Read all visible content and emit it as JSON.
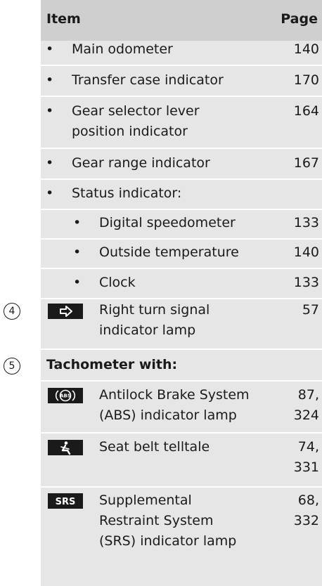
{
  "header": {
    "item": "Item",
    "page": "Page"
  },
  "rows": [
    {
      "label": "Main odometer",
      "page": "140"
    },
    {
      "label": "Transfer case indicator",
      "page": "170"
    },
    {
      "label_line1": "Gear selector lever",
      "label_line2": "position indicator",
      "page": "164"
    },
    {
      "label": "Gear range indicator",
      "page": "167"
    },
    {
      "label": "Status indicator:"
    },
    {
      "label": "Digital speedometer",
      "page": "133"
    },
    {
      "label": "Outside temperature",
      "page": "140"
    },
    {
      "label": "Clock",
      "page": "133"
    }
  ],
  "item4": {
    "number": "4",
    "icon": "right-turn-arrow-icon",
    "label_line1": "Right turn signal",
    "label_line2": "indicator lamp",
    "page": "57"
  },
  "item5": {
    "number": "5",
    "label": "Tachometer with:"
  },
  "abs": {
    "icon": "abs-icon",
    "icon_text": "ABS",
    "label_line1": "Antilock Brake System",
    "label_line2": "(ABS) indicator lamp",
    "page_line1": "87,",
    "page_line2": "324"
  },
  "seatbelt": {
    "icon": "seatbelt-person-icon",
    "label": "Seat belt telltale",
    "page_line1": "74,",
    "page_line2": "331"
  },
  "srs": {
    "icon_text": "SRS",
    "label_line1": "Supplemental",
    "label_line2": "Restraint System",
    "label_line3": "(SRS) indicator lamp",
    "page_line1": "68,",
    "page_line2": "332"
  },
  "bullet": "•"
}
